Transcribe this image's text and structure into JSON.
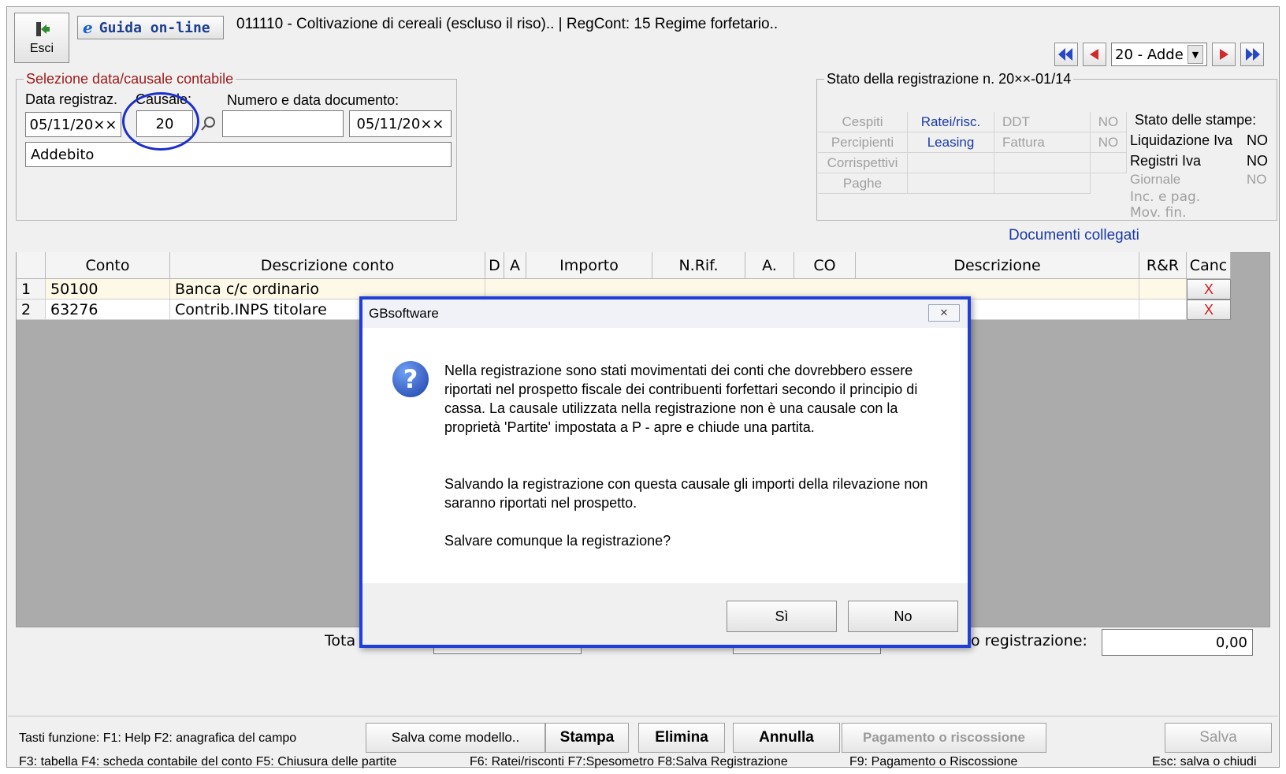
{
  "header": {
    "exit_label": "Esci",
    "help_label": "Guida on-line",
    "title": "011110 - Coltivazione di cereali (escluso il riso).. | RegCont: 15 Regime forfetario..",
    "nav_select_value": "20 - Adde"
  },
  "selezione": {
    "legend": "Selezione data/causale contabile",
    "data_label": "Data registraz.",
    "causale_label": "Causale:",
    "numero_label": "Numero e data documento:",
    "data_value": "05/11/20××",
    "causale_value": "20",
    "numero_value": "",
    "doc_date_value": "05/11/20××",
    "desc_value": "Addebito"
  },
  "stato": {
    "legend": "Stato della registrazione n. 20××-01/14",
    "col1": [
      "Cespiti",
      "Percipienti",
      "Corrispettivi",
      "Paghe"
    ],
    "ratei": "Ratei/risc.",
    "leasing": "Leasing",
    "ddt": "DDT",
    "fattura": "Fattura",
    "no1": "NO",
    "no2": "NO",
    "stampe_title": "Stato delle stampe:",
    "stampe": [
      {
        "label": "Liquidazione Iva",
        "value": "NO"
      },
      {
        "label": "Registri Iva",
        "value": "NO"
      },
      {
        "label": "Giornale",
        "value": "NO"
      },
      {
        "label": "Inc. e pag.",
        "value": ""
      },
      {
        "label": "Mov. fin.",
        "value": ""
      }
    ]
  },
  "documenti_link": "Documenti collegati",
  "grid": {
    "headers": {
      "conto": "Conto",
      "desc": "Descrizione conto",
      "d": "D",
      "a": "A",
      "importo": "Importo",
      "nrif": "N.Rif.",
      "a2": "A.",
      "co": "CO",
      "descrizione": "Descrizione",
      "rr": "R&R",
      "canc": "Canc"
    },
    "rows": [
      {
        "n": "1",
        "conto": "50100",
        "desc": "Banca c/c ordinario",
        "cancel": "X"
      },
      {
        "n": "2",
        "conto": "63276",
        "desc": "Contrib.INPS titolare",
        "cancel": "X"
      }
    ]
  },
  "totals": {
    "totale_label": "Tota",
    "reg_label": "o registrazione:",
    "reg_value": "0,00"
  },
  "toolbar": {
    "f_line1": "Tasti funzione: F1: Help  F2: anagrafica del campo",
    "f_line2": "F3: tabella   F4: scheda contabile del conto  F5: Chiusura delle partite",
    "f_line3": "F6: Ratei/risconti  F7:Spesometro  F8:Salva Registrazione",
    "f_line4": "F9: Pagamento o Riscossione",
    "f_line5": "Esc: salva o chiudi",
    "salva_modello": "Salva come modello..",
    "stampa": "Stampa",
    "elimina": "Elimina",
    "annulla": "Annulla",
    "pagamento": "Pagamento o riscossione",
    "salva": "Salva"
  },
  "dialog": {
    "title": "GBsoftware",
    "message1": "Nella registrazione sono stati movimentati dei conti che dovrebbero essere riportati nel prospetto fiscale dei contribuenti forfettari secondo il principio di cassa. La causale utilizzata nella registrazione non è una causale con la proprietà 'Partite' impostata a P - apre e chiude una partita.",
    "message2": "Salvando la registrazione con questa causale gli importi della rilevazione non saranno riportati nel prospetto.",
    "message3": "Salvare comunque la registrazione?",
    "yes": "Sì",
    "no": "No",
    "close_glyph": "✕",
    "icon_glyph": "?"
  },
  "colors": {
    "dialog_border": "#1f3fd8",
    "annotation_circle": "#1a2fcc",
    "legend_red": "#9b1c1c",
    "link_blue": "#1a3aa8",
    "cancel_red": "#d31c1c"
  }
}
